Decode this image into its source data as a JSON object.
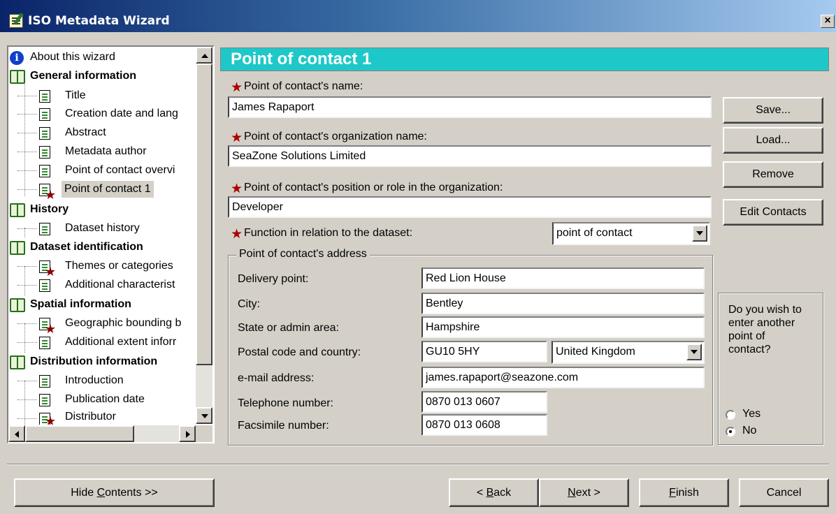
{
  "window": {
    "title": "ISO Metadata Wizard",
    "close_glyph": "×"
  },
  "tree": {
    "items": [
      {
        "label": "About this wizard",
        "type": "info"
      },
      {
        "label": "General information",
        "type": "book"
      },
      {
        "label": "Title",
        "type": "page"
      },
      {
        "label": "Creation date and lang",
        "type": "page"
      },
      {
        "label": "Abstract",
        "type": "page"
      },
      {
        "label": "Metadata author",
        "type": "page"
      },
      {
        "label": "Point of contact overvi",
        "type": "page"
      },
      {
        "label": "Point of contact 1",
        "type": "page-required",
        "selected": true
      },
      {
        "label": "History",
        "type": "book"
      },
      {
        "label": "Dataset history",
        "type": "page"
      },
      {
        "label": "Dataset identification",
        "type": "book"
      },
      {
        "label": "Themes or categories",
        "type": "page-required"
      },
      {
        "label": "Additional characterist",
        "type": "page"
      },
      {
        "label": "Spatial information",
        "type": "book"
      },
      {
        "label": "Geographic bounding b",
        "type": "page-required"
      },
      {
        "label": "Additional extent inforr",
        "type": "page"
      },
      {
        "label": "Distribution information",
        "type": "book"
      },
      {
        "label": "Introduction",
        "type": "page"
      },
      {
        "label": "Publication date",
        "type": "page"
      },
      {
        "label": "Distributor",
        "type": "page-required"
      }
    ]
  },
  "section": {
    "title": "Point of contact 1"
  },
  "form": {
    "name_label": "Point of contact's name:",
    "name_value": "James Rapaport",
    "org_label": "Point of contact's organization name:",
    "org_value": "SeaZone Solutions Limited",
    "role_label": "Point of contact's position or role in the organization:",
    "role_value": "Developer",
    "function_label": "Function in relation to the dataset:",
    "function_value": "point of contact",
    "required_glyph": "★"
  },
  "address": {
    "legend": "Point of contact's address",
    "delivery_label": "Delivery point:",
    "delivery_value": "Red Lion House",
    "city_label": "City:",
    "city_value": "Bentley",
    "state_label": "State or admin area:",
    "state_value": "Hampshire",
    "postal_label": "Postal code and country:",
    "postal_value": "GU10 5HY",
    "country_value": "United Kingdom",
    "email_label": "e-mail address:",
    "email_value": "james.rapaport@seazone.com",
    "phone_label": "Telephone number:",
    "phone_value": "0870 013 0607",
    "fax_label": "Facsimile number:",
    "fax_value": "0870 013 0608"
  },
  "side_buttons": {
    "save": "Save...",
    "load": "Load...",
    "remove": "Remove",
    "edit_contacts": "Edit Contacts"
  },
  "question": {
    "text_lines": [
      "Do you wish to",
      "enter another",
      "point of",
      "contact?"
    ],
    "yes_label": "Yes",
    "no_label": "No",
    "selected": "No"
  },
  "footer": {
    "hide_contents": {
      "before": "Hide ",
      "mnemonic": "C",
      "after": "ontents >>"
    },
    "back": {
      "before": "< ",
      "mnemonic": "B",
      "after": "ack"
    },
    "next": {
      "before": "",
      "mnemonic": "N",
      "after": "ext >"
    },
    "finish": {
      "before": "",
      "mnemonic": "F",
      "after": "inish"
    },
    "cancel": "Cancel"
  },
  "colors": {
    "header_bg": "#1ec8c8",
    "required": "#aa0000",
    "dialog_bg": "#d4d0c8",
    "titlebar": "#0a246a"
  }
}
